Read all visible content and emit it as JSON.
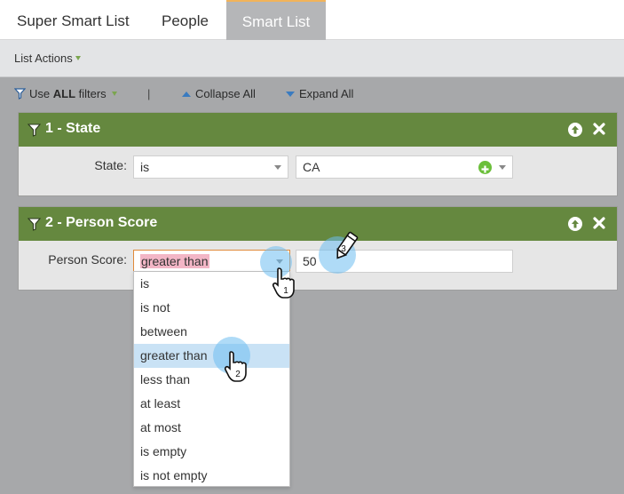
{
  "tabs": [
    {
      "label": "Super Smart List"
    },
    {
      "label": "People"
    },
    {
      "label": "Smart List",
      "active": true
    }
  ],
  "actions": {
    "label": "List Actions"
  },
  "filter_toolbar": {
    "use_prefix": "Use ",
    "use_bold": "ALL",
    "use_suffix": " filters",
    "separator": "|",
    "collapse_label": "Collapse All",
    "expand_label": "Expand All"
  },
  "filters": [
    {
      "title": "1 - State",
      "field_label": "State:",
      "operator": "is",
      "value": "CA"
    },
    {
      "title": "2 - Person Score",
      "field_label": "Person Score:",
      "operator": "greater than",
      "value": "50"
    }
  ],
  "operator_options": [
    "is",
    "is not",
    "between",
    "greater than",
    "less than",
    "at least",
    "at most",
    "is empty",
    "is not empty"
  ],
  "selected_option": "greater than",
  "steps": [
    "1",
    "2",
    "3"
  ],
  "colors": {
    "header_green": "#65883f",
    "tab_accent": "#f1b35a",
    "selection_blue": "#c9e2f5",
    "highlight_pink": "#f3b6c6"
  },
  "icons": {
    "filter": "funnel-icon",
    "move_up": "arrow-up-circle-icon",
    "remove": "close-icon",
    "add": "plus-circle-icon",
    "pointer": "hand-pointer-icon",
    "edit": "pencil-icon"
  }
}
